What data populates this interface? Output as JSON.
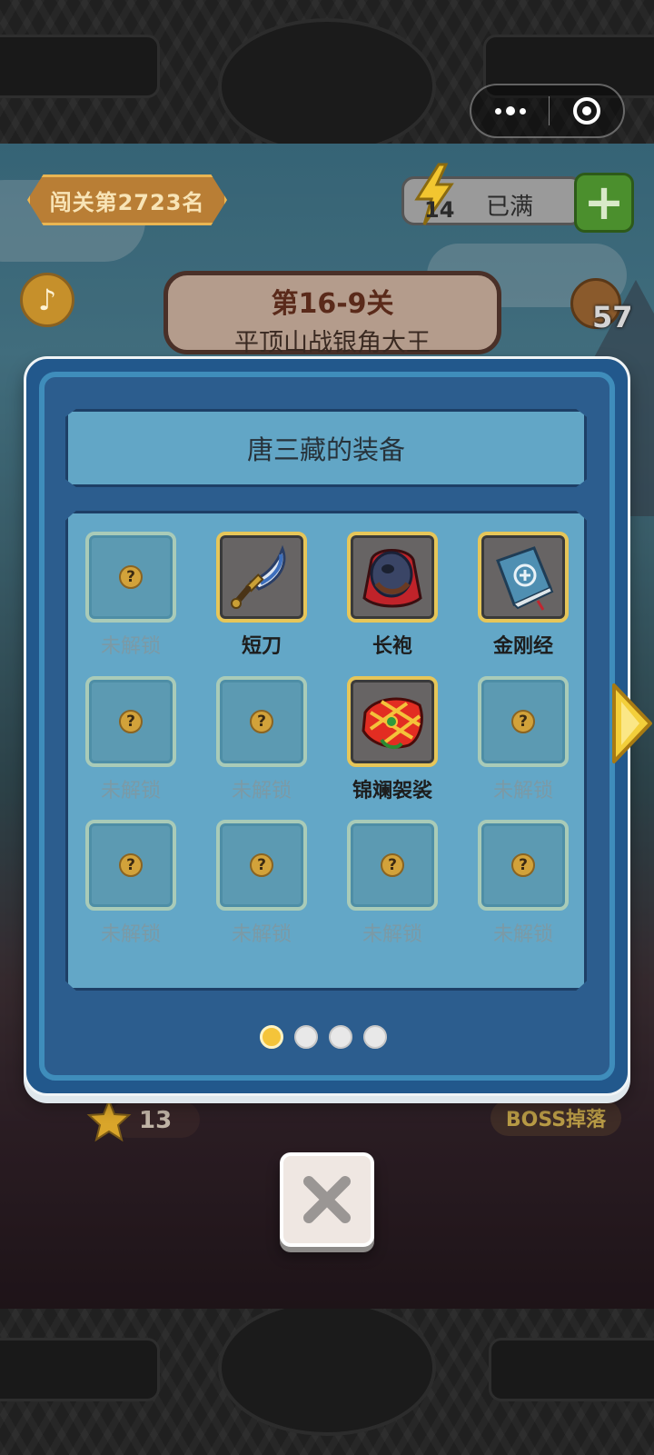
{
  "game": {
    "rank_label": "闯关第2723名",
    "energy": {
      "count": "14",
      "status": "已满"
    },
    "level": {
      "number": "第16-9关",
      "name": "平顶山战银角大王"
    },
    "coins": "57",
    "stars": "13",
    "boss_drop": "BOSS掉落"
  },
  "dialog": {
    "title": "唐三藏的装备",
    "page_count": 4,
    "active_page": 1,
    "slots": [
      {
        "label": "未解锁",
        "state": "locked",
        "icon": "question-icon"
      },
      {
        "label": "短刀",
        "state": "unlocked",
        "icon": "dagger-icon"
      },
      {
        "label": "长袍",
        "state": "unlocked",
        "icon": "robe-icon"
      },
      {
        "label": "金刚经",
        "state": "unlocked",
        "icon": "sutra-book-icon"
      },
      {
        "label": "未解锁",
        "state": "locked",
        "icon": "question-icon"
      },
      {
        "label": "未解锁",
        "state": "locked",
        "icon": "question-icon"
      },
      {
        "label": "锦斓袈裟",
        "state": "unlocked",
        "icon": "kasaya-icon"
      },
      {
        "label": "未解锁",
        "state": "locked",
        "icon": "question-icon"
      },
      {
        "label": "未解锁",
        "state": "locked",
        "icon": "question-icon"
      },
      {
        "label": "未解锁",
        "state": "locked",
        "icon": "question-icon"
      },
      {
        "label": "未解锁",
        "state": "locked",
        "icon": "question-icon"
      },
      {
        "label": "未解锁",
        "state": "locked",
        "icon": "question-icon"
      }
    ]
  },
  "colors": {
    "dialog_bg": "#22588c",
    "panel_bg": "#63a7c7",
    "gold_border": "#e6c659",
    "locked_text": "#7b9aa6"
  }
}
